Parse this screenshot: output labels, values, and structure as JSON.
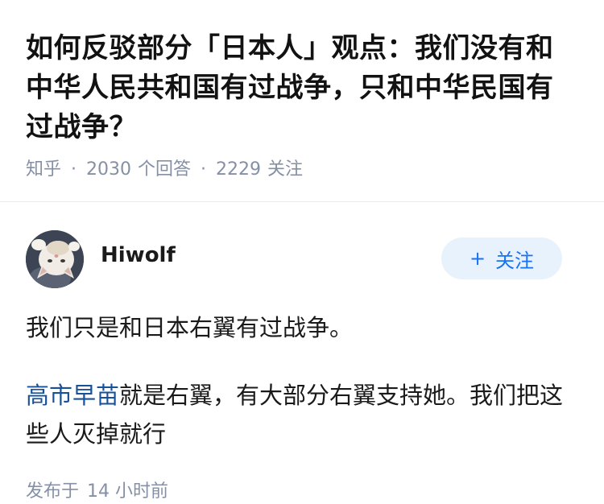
{
  "question": {
    "title": "如何反驳部分「日本人」观点：我们没有和中华人民共和国有过战争，只和中华民国有过战争？",
    "source": "知乎",
    "answer_count": "2030",
    "answer_label": "个回答",
    "follower_count": "2229",
    "follower_label": "关注",
    "separator": "·"
  },
  "answer": {
    "author": {
      "name": "Hiwolf",
      "avatar_icon": "cat-avatar"
    },
    "follow_button": {
      "icon": "+",
      "label": "关注"
    },
    "paragraphs": {
      "p1": "我们只是和日本右翼有过战争。",
      "p2_link": "高市早苗",
      "p2_rest": "就是右翼，有大部分右翼支持她。我们把这些人灭掉就行"
    },
    "published": {
      "label": "发布于",
      "time": "14 小时前"
    }
  },
  "colors": {
    "meta_gray": "#8590a6",
    "link_blue": "#175199",
    "button_blue": "#1772f6",
    "button_bg": "#e8f2fc",
    "title_text": "#121212"
  }
}
